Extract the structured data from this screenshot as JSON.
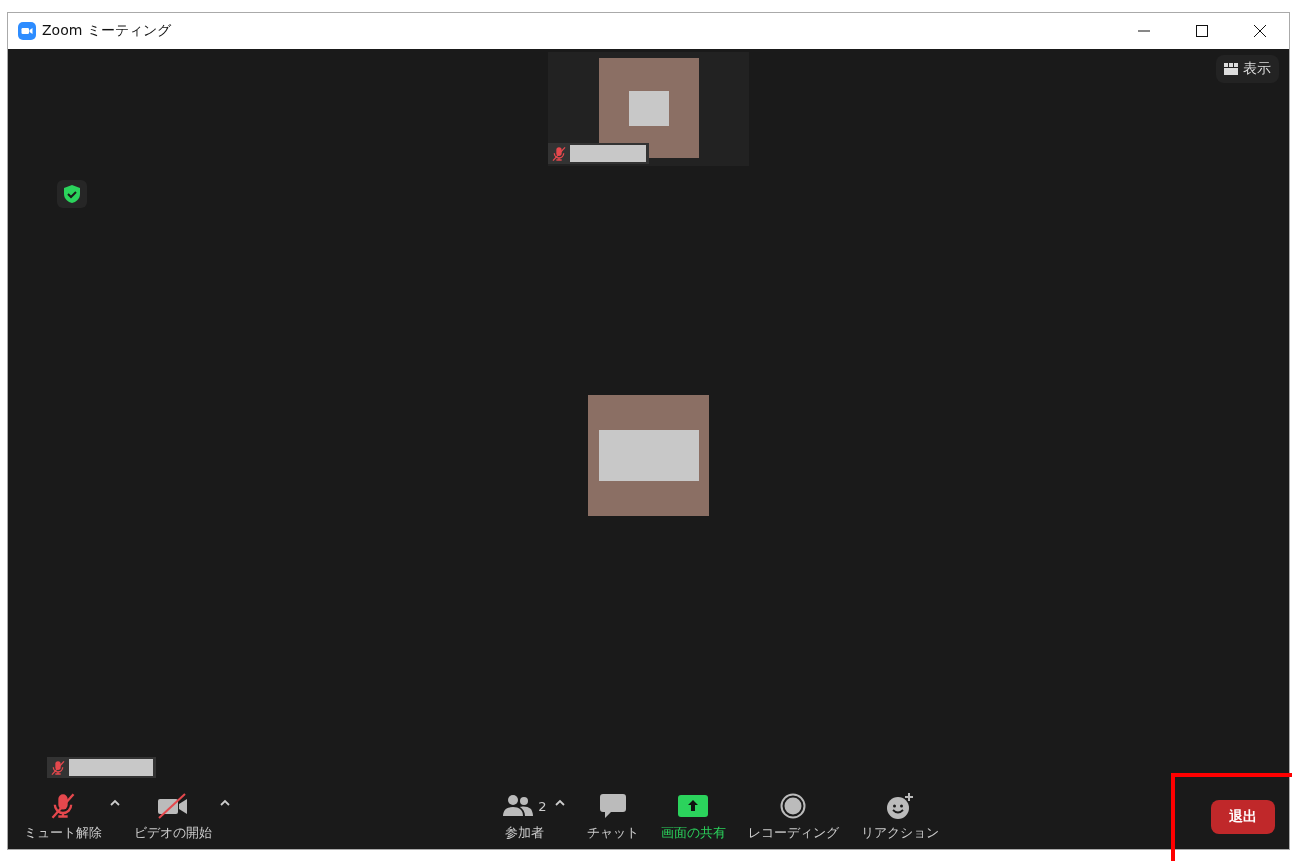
{
  "window": {
    "title": "Zoom ミーティング"
  },
  "view_button": {
    "label": "表示"
  },
  "thumbnail": {
    "muted": true
  },
  "self_label": {
    "muted": true
  },
  "toolbar": {
    "items": [
      {
        "kind": "mic",
        "label": "ミュート解除",
        "off": true,
        "caret": true
      },
      {
        "kind": "video",
        "label": "ビデオの開始",
        "off": true,
        "caret": true
      },
      {
        "kind": "participants",
        "label": "参加者",
        "count": "2",
        "caret": true
      },
      {
        "kind": "chat",
        "label": "チャット"
      },
      {
        "kind": "share",
        "label": "画面の共有",
        "highlighted": true
      },
      {
        "kind": "record",
        "label": "レコーディング"
      },
      {
        "kind": "reaction",
        "label": "リアクション"
      }
    ],
    "leave_button": {
      "label": "退出"
    }
  }
}
